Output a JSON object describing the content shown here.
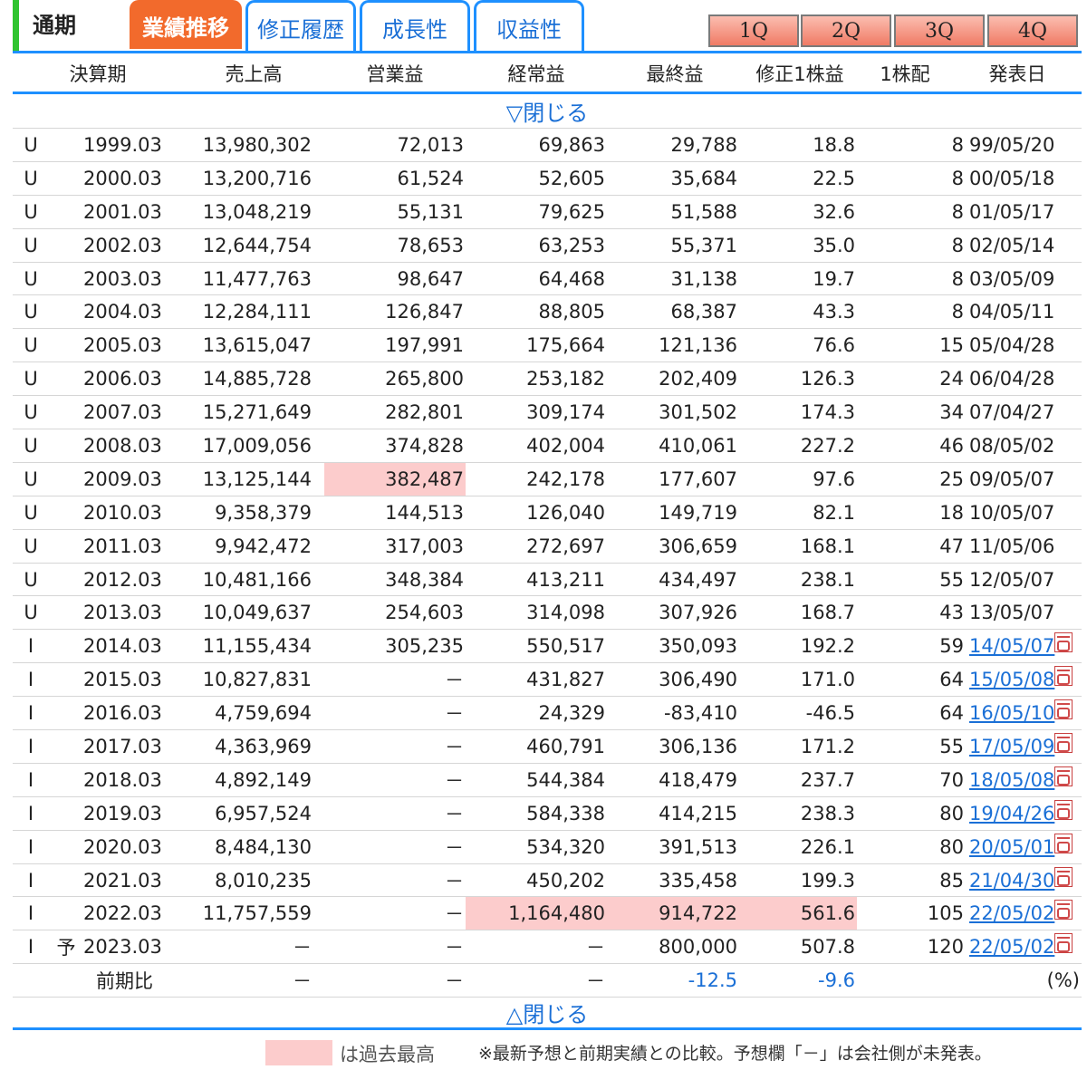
{
  "tabs": {
    "period": "通期",
    "results": "業績推移",
    "revisions": "修正履歴",
    "growth": "成長性",
    "profit": "収益性"
  },
  "quarters": [
    "1Q",
    "2Q",
    "3Q",
    "4Q"
  ],
  "headers": {
    "period": "決算期",
    "sales": "売上高",
    "operating": "営業益",
    "ordinary": "経常益",
    "net": "最終益",
    "eps": "修正1株益",
    "dividend": "1株配",
    "date": "発表日"
  },
  "toggle": {
    "close_top": "▽閉じる",
    "close_bottom": "△閉じる"
  },
  "rows": [
    {
      "type": "U",
      "fc": "",
      "period": "1999.03",
      "sales": "13,980,302",
      "op": "72,013",
      "ord": "69,863",
      "net": "29,788",
      "eps": "18.8",
      "div": "8",
      "date": "99/05/20",
      "link": false
    },
    {
      "type": "U",
      "fc": "",
      "period": "2000.03",
      "sales": "13,200,716",
      "op": "61,524",
      "ord": "52,605",
      "net": "35,684",
      "eps": "22.5",
      "div": "8",
      "date": "00/05/18",
      "link": false
    },
    {
      "type": "U",
      "fc": "",
      "period": "2001.03",
      "sales": "13,048,219",
      "op": "55,131",
      "ord": "79,625",
      "net": "51,588",
      "eps": "32.6",
      "div": "8",
      "date": "01/05/17",
      "link": false
    },
    {
      "type": "U",
      "fc": "",
      "period": "2002.03",
      "sales": "12,644,754",
      "op": "78,653",
      "ord": "63,253",
      "net": "55,371",
      "eps": "35.0",
      "div": "8",
      "date": "02/05/14",
      "link": false
    },
    {
      "type": "U",
      "fc": "",
      "period": "2003.03",
      "sales": "11,477,763",
      "op": "98,647",
      "ord": "64,468",
      "net": "31,138",
      "eps": "19.7",
      "div": "8",
      "date": "03/05/09",
      "link": false
    },
    {
      "type": "U",
      "fc": "",
      "period": "2004.03",
      "sales": "12,284,111",
      "op": "126,847",
      "ord": "88,805",
      "net": "68,387",
      "eps": "43.3",
      "div": "8",
      "date": "04/05/11",
      "link": false
    },
    {
      "type": "U",
      "fc": "",
      "period": "2005.03",
      "sales": "13,615,047",
      "op": "197,991",
      "ord": "175,664",
      "net": "121,136",
      "eps": "76.6",
      "div": "15",
      "date": "05/04/28",
      "link": false
    },
    {
      "type": "U",
      "fc": "",
      "period": "2006.03",
      "sales": "14,885,728",
      "op": "265,800",
      "ord": "253,182",
      "net": "202,409",
      "eps": "126.3",
      "div": "24",
      "date": "06/04/28",
      "link": false
    },
    {
      "type": "U",
      "fc": "",
      "period": "2007.03",
      "sales": "15,271,649",
      "op": "282,801",
      "ord": "309,174",
      "net": "301,502",
      "eps": "174.3",
      "div": "34",
      "date": "07/04/27",
      "link": false
    },
    {
      "type": "U",
      "fc": "",
      "period": "2008.03",
      "sales": "17,009,056",
      "op": "374,828",
      "ord": "402,004",
      "net": "410,061",
      "eps": "227.2",
      "div": "46",
      "date": "08/05/02",
      "link": false
    },
    {
      "type": "U",
      "fc": "",
      "period": "2009.03",
      "sales": "13,125,144",
      "op": "382,487",
      "ord": "242,178",
      "net": "177,607",
      "eps": "97.6",
      "div": "25",
      "date": "09/05/07",
      "link": false,
      "hl": [
        "op"
      ]
    },
    {
      "type": "U",
      "fc": "",
      "period": "2010.03",
      "sales": "9,358,379",
      "op": "144,513",
      "ord": "126,040",
      "net": "149,719",
      "eps": "82.1",
      "div": "18",
      "date": "10/05/07",
      "link": false
    },
    {
      "type": "U",
      "fc": "",
      "period": "2011.03",
      "sales": "9,942,472",
      "op": "317,003",
      "ord": "272,697",
      "net": "306,659",
      "eps": "168.1",
      "div": "47",
      "date": "11/05/06",
      "link": false
    },
    {
      "type": "U",
      "fc": "",
      "period": "2012.03",
      "sales": "10,481,166",
      "op": "348,384",
      "ord": "413,211",
      "net": "434,497",
      "eps": "238.1",
      "div": "55",
      "date": "12/05/07",
      "link": false
    },
    {
      "type": "U",
      "fc": "",
      "period": "2013.03",
      "sales": "10,049,637",
      "op": "254,603",
      "ord": "314,098",
      "net": "307,926",
      "eps": "168.7",
      "div": "43",
      "date": "13/05/07",
      "link": false
    },
    {
      "type": "I",
      "fc": "",
      "period": "2014.03",
      "sales": "11,155,434",
      "op": "305,235",
      "ord": "550,517",
      "net": "350,093",
      "eps": "192.2",
      "div": "59",
      "date": "14/05/07",
      "link": true
    },
    {
      "type": "I",
      "fc": "",
      "period": "2015.03",
      "sales": "10,827,831",
      "op": "－",
      "ord": "431,827",
      "net": "306,490",
      "eps": "171.0",
      "div": "64",
      "date": "15/05/08",
      "link": true
    },
    {
      "type": "I",
      "fc": "",
      "period": "2016.03",
      "sales": "4,759,694",
      "op": "－",
      "ord": "24,329",
      "net": "-83,410",
      "eps": "-46.5",
      "div": "64",
      "date": "16/05/10",
      "link": true
    },
    {
      "type": "I",
      "fc": "",
      "period": "2017.03",
      "sales": "4,363,969",
      "op": "－",
      "ord": "460,791",
      "net": "306,136",
      "eps": "171.2",
      "div": "55",
      "date": "17/05/09",
      "link": true
    },
    {
      "type": "I",
      "fc": "",
      "period": "2018.03",
      "sales": "4,892,149",
      "op": "－",
      "ord": "544,384",
      "net": "418,479",
      "eps": "237.7",
      "div": "70",
      "date": "18/05/08",
      "link": true
    },
    {
      "type": "I",
      "fc": "",
      "period": "2019.03",
      "sales": "6,957,524",
      "op": "－",
      "ord": "584,338",
      "net": "414,215",
      "eps": "238.3",
      "div": "80",
      "date": "19/04/26",
      "link": true
    },
    {
      "type": "I",
      "fc": "",
      "period": "2020.03",
      "sales": "8,484,130",
      "op": "－",
      "ord": "534,320",
      "net": "391,513",
      "eps": "226.1",
      "div": "80",
      "date": "20/05/01",
      "link": true
    },
    {
      "type": "I",
      "fc": "",
      "period": "2021.03",
      "sales": "8,010,235",
      "op": "－",
      "ord": "450,202",
      "net": "335,458",
      "eps": "199.3",
      "div": "85",
      "date": "21/04/30",
      "link": true
    },
    {
      "type": "I",
      "fc": "",
      "period": "2022.03",
      "sales": "11,757,559",
      "op": "－",
      "ord": "1,164,480",
      "net": "914,722",
      "eps": "561.6",
      "div": "105",
      "date": "22/05/02",
      "link": true,
      "hl": [
        "ord",
        "net",
        "eps"
      ]
    },
    {
      "type": "I",
      "fc": "予",
      "period": "2023.03",
      "sales": "－",
      "op": "－",
      "ord": "－",
      "net": "800,000",
      "eps": "507.8",
      "div": "120",
      "date": "22/05/02",
      "link": true
    }
  ],
  "comparison": {
    "label": "前期比",
    "sales": "－",
    "op": "－",
    "ord": "－",
    "net": "-12.5",
    "eps": "-9.6",
    "unit": "(%)"
  },
  "legend": {
    "text": "は過去最高",
    "note": "※最新予想と前期実績との比較。予想欄「－」は会社側が未発表。"
  }
}
